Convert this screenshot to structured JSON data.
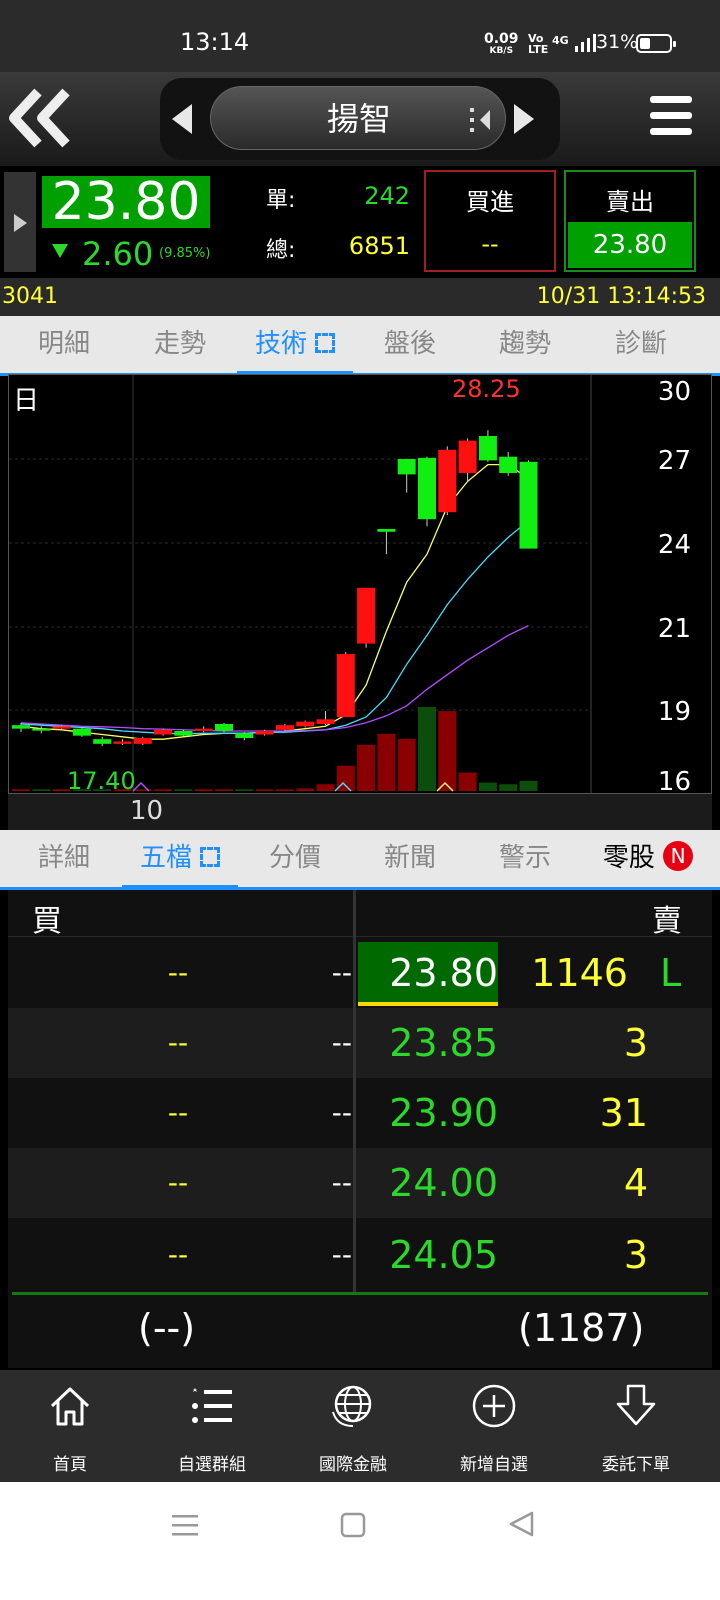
{
  "status_bar": {
    "time": "13:14",
    "net_speed": "0.09",
    "net_unit": "KB/S",
    "volte": "Vo LTE",
    "signal": "4G",
    "battery": "31%"
  },
  "header": {
    "stock_name": "揚智"
  },
  "quote": {
    "last_price": "23.80",
    "change": "2.60",
    "change_pct": "(9.85%)",
    "single_label": "單:",
    "single_value": "242",
    "total_label": "總:",
    "total_value": "6851",
    "buy_label": "買進",
    "buy_value": "--",
    "sell_label": "賣出",
    "sell_value": "23.80"
  },
  "info": {
    "code": "3041",
    "datetime": "10/31 13:14:53"
  },
  "top_tabs": [
    {
      "label": "明細"
    },
    {
      "label": "走勢"
    },
    {
      "label": "技術"
    },
    {
      "label": "盤後"
    },
    {
      "label": "趨勢"
    },
    {
      "label": "診斷"
    }
  ],
  "bottom_tabs": [
    {
      "label": "詳細"
    },
    {
      "label": "五檔"
    },
    {
      "label": "分價"
    },
    {
      "label": "新聞"
    },
    {
      "label": "警示"
    },
    {
      "label": "零股"
    }
  ],
  "bottom_tab_badge": "N",
  "chart_data": {
    "type": "candlestick",
    "period_label": "日",
    "high_label": "28.25",
    "low_label": "17.40",
    "x_tick_label": "10",
    "y_ticks": [
      "30",
      "27",
      "24",
      "21",
      "19",
      "16"
    ],
    "ylim": [
      16,
      30
    ],
    "candles": [
      {
        "o": 18.35,
        "c": 18.2,
        "h": 18.45,
        "l": 18.05
      },
      {
        "o": 18.2,
        "c": 18.15,
        "h": 18.3,
        "l": 18.0
      },
      {
        "o": 18.2,
        "c": 18.3,
        "h": 18.35,
        "l": 18.15
      },
      {
        "o": 18.2,
        "c": 17.9,
        "h": 18.25,
        "l": 17.85
      },
      {
        "o": 17.75,
        "c": 17.55,
        "h": 17.85,
        "l": 17.45
      },
      {
        "o": 17.55,
        "c": 17.65,
        "h": 17.75,
        "l": 17.5
      },
      {
        "o": 17.55,
        "c": 17.8,
        "h": 17.85,
        "l": 17.5
      },
      {
        "o": 17.95,
        "c": 18.15,
        "h": 18.2,
        "l": 17.9
      },
      {
        "o": 18.1,
        "c": 17.9,
        "h": 18.15,
        "l": 17.85
      },
      {
        "o": 18.1,
        "c": 18.2,
        "h": 18.3,
        "l": 18.05
      },
      {
        "o": 18.4,
        "c": 18.1,
        "h": 18.45,
        "l": 18.05
      },
      {
        "o": 18.0,
        "c": 17.8,
        "h": 18.05,
        "l": 17.7
      },
      {
        "o": 17.95,
        "c": 18.1,
        "h": 18.15,
        "l": 17.9
      },
      {
        "o": 18.15,
        "c": 18.35,
        "h": 18.4,
        "l": 18.1
      },
      {
        "o": 18.3,
        "c": 18.5,
        "h": 18.55,
        "l": 18.25
      },
      {
        "o": 18.4,
        "c": 18.6,
        "h": 18.95,
        "l": 18.35
      },
      {
        "o": 18.7,
        "c": 20.35,
        "h": 20.4,
        "l": 18.7
      },
      {
        "o": 20.6,
        "c": 22.4,
        "h": 22.4,
        "l": 20.5
      },
      {
        "o": 24.5,
        "c": 24.4,
        "h": 24.5,
        "l": 23.6
      },
      {
        "o": 27.0,
        "c": 26.45,
        "h": 27.0,
        "l": 25.8
      },
      {
        "o": 27.05,
        "c": 24.85,
        "h": 27.1,
        "l": 24.6
      },
      {
        "o": 25.1,
        "c": 27.4,
        "h": 27.55,
        "l": 25.0
      },
      {
        "o": 26.5,
        "c": 27.8,
        "h": 27.9,
        "l": 26.2
      },
      {
        "o": 28.0,
        "c": 26.95,
        "h": 28.25,
        "l": 26.9
      },
      {
        "o": 27.1,
        "c": 26.5,
        "h": 27.3,
        "l": 26.4
      },
      {
        "o": 26.9,
        "c": 23.8,
        "h": 26.95,
        "l": 23.8
      }
    ],
    "ma": [
      {
        "color": "#ffff66",
        "values": [
          18.3,
          18.2,
          18.15,
          18.05,
          17.95,
          17.85,
          17.75,
          17.75,
          17.85,
          17.95,
          18.0,
          18.0,
          18.05,
          18.1,
          18.2,
          18.3,
          18.8,
          19.6,
          20.9,
          22.6,
          23.6,
          25.3,
          26.2,
          26.8,
          26.8,
          26.3
        ]
      },
      {
        "color": "#44ddff",
        "values": [
          18.4,
          18.35,
          18.3,
          18.25,
          18.2,
          18.1,
          18.05,
          18.0,
          17.98,
          18.0,
          18.0,
          18.0,
          18.05,
          18.05,
          18.1,
          18.15,
          18.35,
          18.7,
          19.3,
          20.1,
          20.8,
          21.8,
          22.7,
          23.5,
          24.2,
          24.8
        ]
      },
      {
        "color": "#b04dff",
        "values": [
          18.45,
          18.4,
          18.35,
          18.3,
          18.28,
          18.25,
          18.2,
          18.18,
          18.15,
          18.12,
          18.1,
          18.1,
          18.1,
          18.1,
          18.12,
          18.15,
          18.25,
          18.45,
          18.75,
          19.1,
          19.5,
          19.85,
          20.2,
          20.5,
          20.8,
          21.05
        ]
      }
    ],
    "volume": [
      2,
      2,
      2,
      2,
      2,
      2,
      2,
      2,
      2,
      2,
      2,
      2,
      2,
      2,
      3,
      8,
      30,
      55,
      68,
      62,
      100,
      95,
      22,
      10,
      8,
      12
    ],
    "volume_color": [
      "r",
      "g",
      "r",
      "g",
      "g",
      "r",
      "r",
      "r",
      "g",
      "r",
      "r",
      "g",
      "r",
      "r",
      "r",
      "r",
      "r",
      "r",
      "r",
      "r",
      "g",
      "r",
      "r",
      "g",
      "g",
      "g"
    ]
  },
  "order_book": {
    "buy_header": "買",
    "sell_header": "賣",
    "rows": [
      {
        "bid_vol": "--",
        "bid_price": "--",
        "ask_price": "23.80",
        "ask_vol": "1146"
      },
      {
        "bid_vol": "--",
        "bid_price": "--",
        "ask_price": "23.85",
        "ask_vol": "3"
      },
      {
        "bid_vol": "--",
        "bid_price": "--",
        "ask_price": "23.90",
        "ask_vol": "31"
      },
      {
        "bid_vol": "--",
        "bid_price": "--",
        "ask_price": "24.00",
        "ask_vol": "4"
      },
      {
        "bid_vol": "--",
        "bid_price": "--",
        "ask_price": "24.05",
        "ask_vol": "3"
      }
    ],
    "limit_mark": "L",
    "buy_total": "(--)",
    "sell_total": "(1187)"
  },
  "bottom_nav": [
    {
      "label": "首頁",
      "icon": "home-icon"
    },
    {
      "label": "自選群組",
      "icon": "list-icon"
    },
    {
      "label": "國際金融",
      "icon": "globe-icon"
    },
    {
      "label": "新增自選",
      "icon": "add-circle-icon"
    },
    {
      "label": "委託下單",
      "icon": "download-arrow-icon"
    }
  ]
}
